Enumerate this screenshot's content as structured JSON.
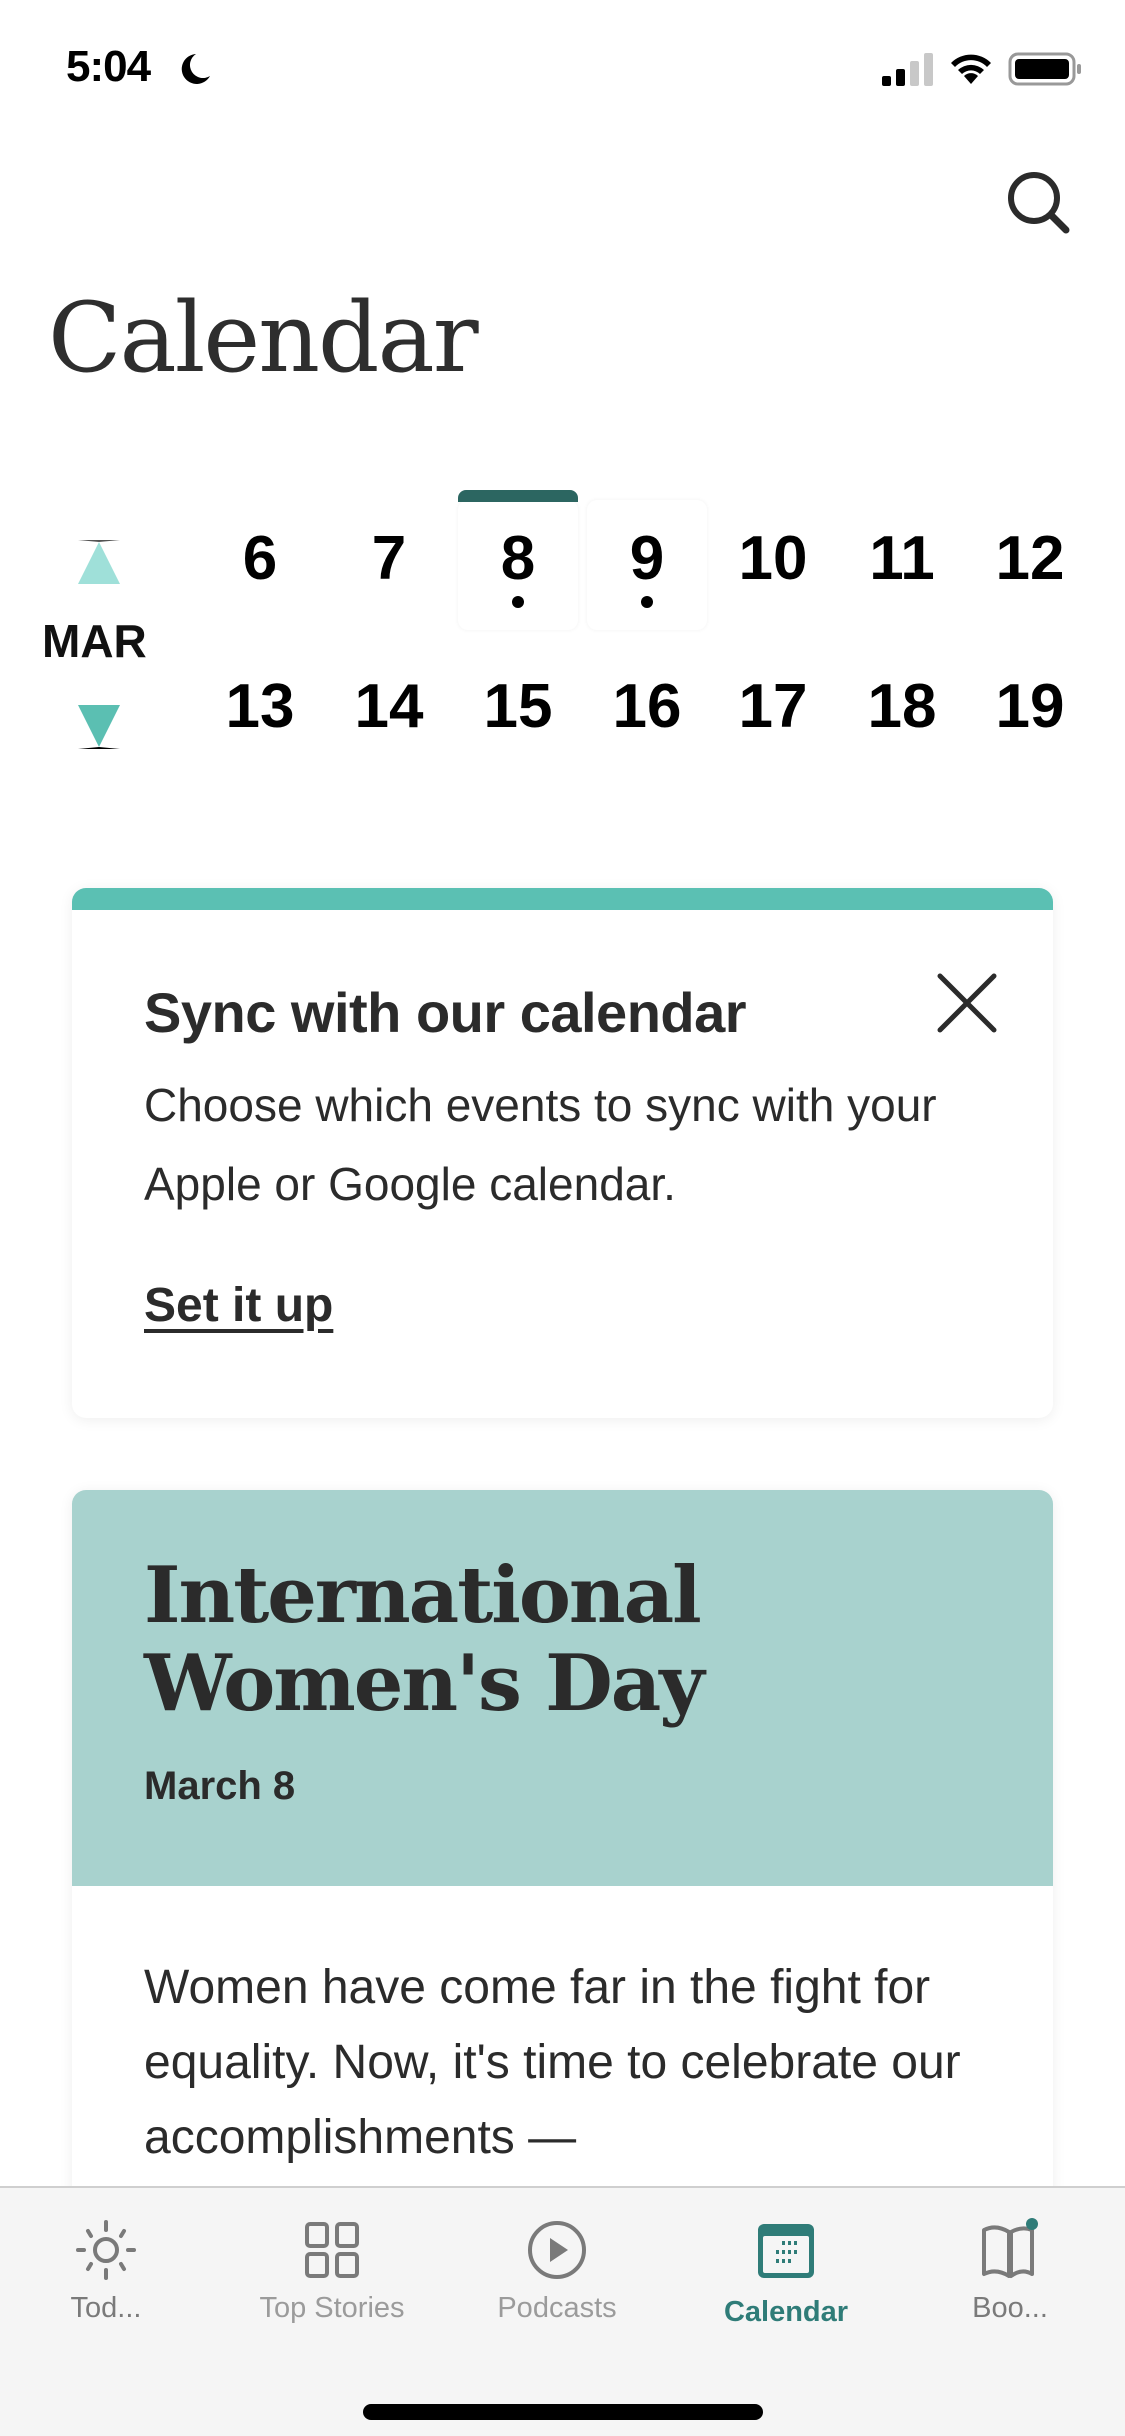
{
  "status_bar": {
    "time": "5:04",
    "icons": [
      "moon-icon",
      "cellular-signal-icon",
      "wifi-icon",
      "battery-icon"
    ]
  },
  "header": {
    "title": "Calendar",
    "search_icon": "search-icon"
  },
  "calendar_strip": {
    "month": "MAR",
    "prev_icon": "triangle-up-icon",
    "next_icon": "triangle-down-icon",
    "weeks": [
      [
        {
          "day": "6",
          "has_event": false
        },
        {
          "day": "7",
          "has_event": false
        },
        {
          "day": "8",
          "has_event": true,
          "selected": true
        },
        {
          "day": "9",
          "has_event": true
        },
        {
          "day": "10",
          "has_event": false
        },
        {
          "day": "11",
          "has_event": false
        },
        {
          "day": "12",
          "has_event": false
        }
      ],
      [
        {
          "day": "13",
          "has_event": false
        },
        {
          "day": "14",
          "has_event": false
        },
        {
          "day": "15",
          "has_event": false
        },
        {
          "day": "16",
          "has_event": false
        },
        {
          "day": "17",
          "has_event": false
        },
        {
          "day": "18",
          "has_event": false
        },
        {
          "day": "19",
          "has_event": false
        }
      ]
    ],
    "selected_color": "#2c6661"
  },
  "sync_card": {
    "title": "Sync with our calendar",
    "description": "Choose which events to sync with your Apple or Google calendar.",
    "link_label": "Set it up",
    "close_icon": "close-icon",
    "accent_color": "#5bc0b3"
  },
  "event_card": {
    "title": "International Women's Day",
    "date": "March 8",
    "body": "Women have come far in the fight for equality. Now, it's time to celebrate our accomplishments —",
    "header_color": "#a8d2ce"
  },
  "tab_bar": {
    "tabs": [
      {
        "label": "Tod...",
        "icon": "sun-icon",
        "active": false
      },
      {
        "label": "Top Stories",
        "icon": "grid-icon",
        "active": false
      },
      {
        "label": "Podcasts",
        "icon": "play-circle-icon",
        "active": false
      },
      {
        "label": "Calendar",
        "icon": "calendar-icon",
        "active": true
      },
      {
        "label": "Boo...",
        "icon": "book-icon",
        "active": false,
        "badge": true
      }
    ],
    "active_color": "#2f7c78"
  }
}
